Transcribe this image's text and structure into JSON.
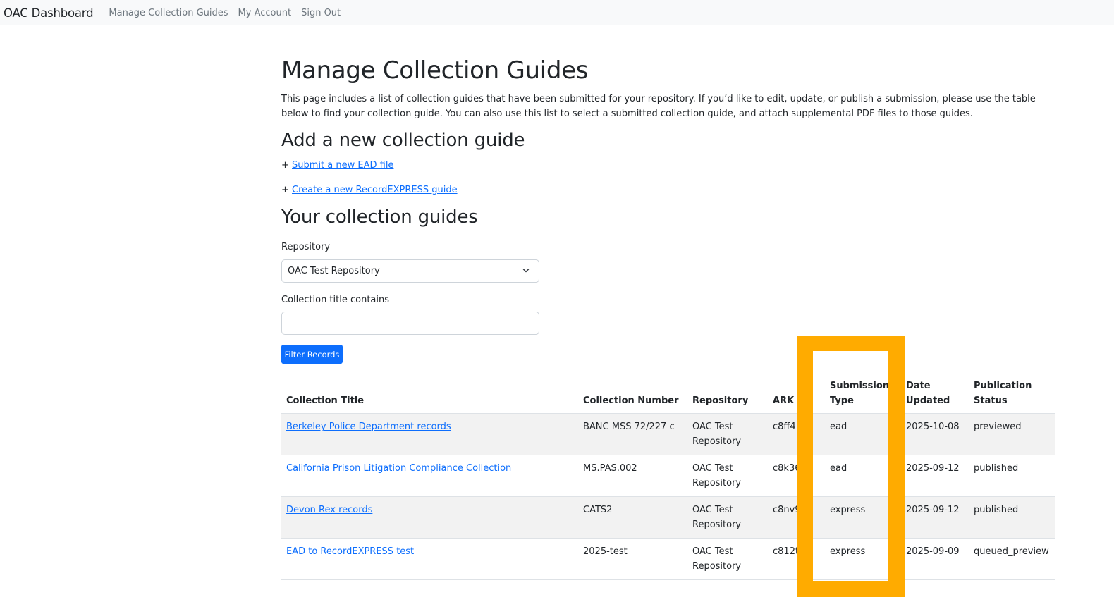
{
  "navbar": {
    "brand": "OAC Dashboard",
    "links": [
      "Manage Collection Guides",
      "My Account",
      "Sign Out"
    ]
  },
  "page": {
    "title": "Manage Collection Guides",
    "intro": "This page includes a list of collection guides that have been submitted for your repository. If you’d like to edit, update, or publish a submission, please use the table below to find your collection guide. You can also use this list to select a submitted collection guide, and attach supplemental PDF files to those guides.",
    "add_heading": "Add a new collection guide",
    "add_links": [
      {
        "prefix": "+ ",
        "label": "Submit a new EAD file"
      },
      {
        "prefix": "+ ",
        "label": "Create a new RecordEXPRESS guide"
      }
    ],
    "your_heading": "Your collection guides"
  },
  "filters": {
    "repository_label": "Repository",
    "repository_value": "OAC Test Repository",
    "title_label": "Collection title contains",
    "title_value": "",
    "button_label": "Filter Records"
  },
  "table": {
    "headers": [
      "Collection Title",
      "Collection Number",
      "Repository",
      "ARK",
      "Submission Type",
      "Date Updated",
      "Publication Status"
    ],
    "header_lines": {
      "submission_1": "Submission",
      "submission_2": "Type",
      "date_1": "Date",
      "date_2": "Updated",
      "pub_1": "Publication",
      "pub_2": "Status"
    },
    "rows": [
      {
        "title": "Berkeley Police Department records",
        "number": "BANC MSS 72/227 c",
        "repo_1": "OAC Test",
        "repo_2": "Repository",
        "ark": "c8ff41",
        "type": "ead",
        "date": "2025-10-08",
        "status": "previewed"
      },
      {
        "title": "California Prison Litigation Compliance Collection",
        "number": "MS.PAS.002",
        "repo_1": "OAC Test",
        "repo_2": "Repository",
        "ark": "c8k36",
        "type": "ead",
        "date": "2025-09-12",
        "status": "published"
      },
      {
        "title": "Devon Rex records",
        "number": "CATS2",
        "repo_1": "OAC Test",
        "repo_2": "Repository",
        "ark": "c8nv9",
        "type": "express",
        "date": "2025-09-12",
        "status": "published"
      },
      {
        "title": "EAD to RecordEXPRESS test",
        "number": "2025-test",
        "repo_1": "OAC Test",
        "repo_2": "Repository",
        "ark": "c812t",
        "type": "express",
        "date": "2025-09-09",
        "status": "queued_preview"
      }
    ]
  },
  "colors": {
    "link": "#0d6efd",
    "highlight": "#ffab00",
    "navbar_bg": "#f8f9fa",
    "button_bg": "#0d6efd"
  }
}
